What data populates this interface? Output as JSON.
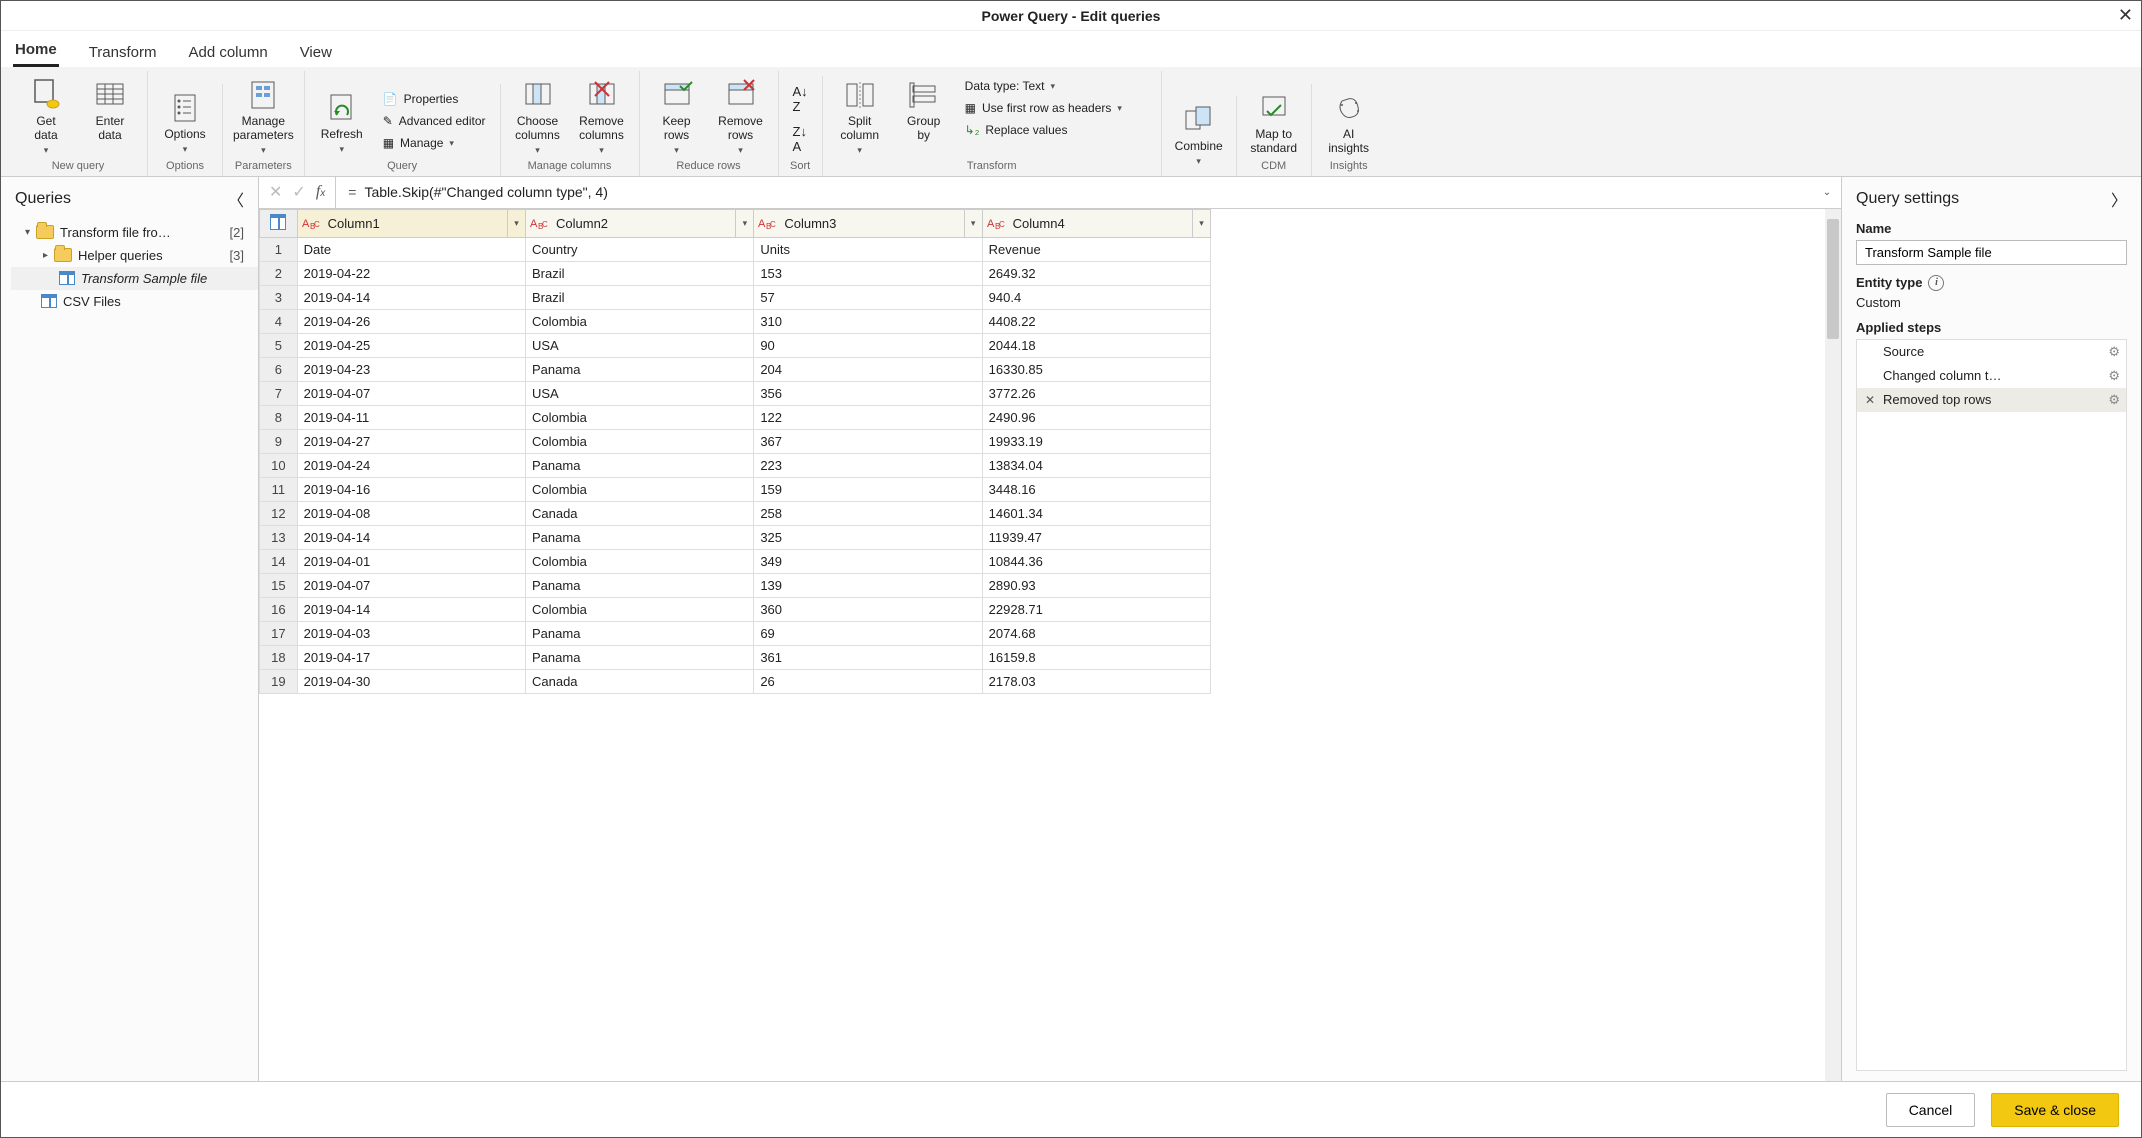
{
  "window": {
    "title": "Power Query - Edit queries"
  },
  "tabs": [
    {
      "label": "Home",
      "active": true
    },
    {
      "label": "Transform",
      "active": false
    },
    {
      "label": "Add column",
      "active": false
    },
    {
      "label": "View",
      "active": false
    }
  ],
  "ribbon": {
    "newquery": {
      "label": "New query",
      "get_data": "Get\ndata",
      "enter_data": "Enter\ndata"
    },
    "options": {
      "label": "Options",
      "options": "Options"
    },
    "parameters": {
      "label": "Parameters",
      "manage_parameters": "Manage\nparameters"
    },
    "query": {
      "label": "Query",
      "refresh": "Refresh",
      "properties": "Properties",
      "advanced_editor": "Advanced editor",
      "manage": "Manage"
    },
    "manage_columns": {
      "label": "Manage columns",
      "choose_columns": "Choose\ncolumns",
      "remove_columns": "Remove\ncolumns"
    },
    "reduce_rows": {
      "label": "Reduce rows",
      "keep_rows": "Keep\nrows",
      "remove_rows": "Remove\nrows"
    },
    "sort": {
      "label": "Sort"
    },
    "transform": {
      "label": "Transform",
      "split_column": "Split\ncolumn",
      "group_by": "Group\nby",
      "data_type": "Data type: Text",
      "first_row_headers": "Use first row as headers",
      "replace_values": "Replace values"
    },
    "combine": {
      "label": "",
      "combine": "Combine"
    },
    "cdm": {
      "label": "CDM",
      "map_to_standard": "Map to\nstandard"
    },
    "insights": {
      "label": "Insights",
      "ai_insights": "AI\ninsights"
    }
  },
  "queries": {
    "title": "Queries",
    "items": [
      {
        "icon": "folder",
        "label": "Transform file fro…",
        "count": "[2]",
        "depth": 0,
        "expand": "▾"
      },
      {
        "icon": "folder",
        "label": "Helper queries",
        "count": "[3]",
        "depth": 1,
        "expand": "▸"
      },
      {
        "icon": "table",
        "label": "Transform Sample file",
        "depth": 1,
        "selected": true
      },
      {
        "icon": "table",
        "label": "CSV Files",
        "depth": 0
      }
    ]
  },
  "formula": {
    "code": "Table.Skip(#\"Changed column type\", 4)"
  },
  "table": {
    "columns": [
      "Column1",
      "Column2",
      "Column3",
      "Column4"
    ],
    "selected_col": 0,
    "rows": [
      {
        "n": 1,
        "c": [
          "Date",
          "Country",
          "Units",
          "Revenue"
        ]
      },
      {
        "n": 2,
        "c": [
          "2019-04-22",
          "Brazil",
          "153",
          "2649.32"
        ]
      },
      {
        "n": 3,
        "c": [
          "2019-04-14",
          "Brazil",
          "57",
          "940.4"
        ]
      },
      {
        "n": 4,
        "c": [
          "2019-04-26",
          "Colombia",
          "310",
          "4408.22"
        ]
      },
      {
        "n": 5,
        "c": [
          "2019-04-25",
          "USA",
          "90",
          "2044.18"
        ]
      },
      {
        "n": 6,
        "c": [
          "2019-04-23",
          "Panama",
          "204",
          "16330.85"
        ]
      },
      {
        "n": 7,
        "c": [
          "2019-04-07",
          "USA",
          "356",
          "3772.26"
        ]
      },
      {
        "n": 8,
        "c": [
          "2019-04-11",
          "Colombia",
          "122",
          "2490.96"
        ]
      },
      {
        "n": 9,
        "c": [
          "2019-04-27",
          "Colombia",
          "367",
          "19933.19"
        ]
      },
      {
        "n": 10,
        "c": [
          "2019-04-24",
          "Panama",
          "223",
          "13834.04"
        ]
      },
      {
        "n": 11,
        "c": [
          "2019-04-16",
          "Colombia",
          "159",
          "3448.16"
        ]
      },
      {
        "n": 12,
        "c": [
          "2019-04-08",
          "Canada",
          "258",
          "14601.34"
        ]
      },
      {
        "n": 13,
        "c": [
          "2019-04-14",
          "Panama",
          "325",
          "11939.47"
        ]
      },
      {
        "n": 14,
        "c": [
          "2019-04-01",
          "Colombia",
          "349",
          "10844.36"
        ]
      },
      {
        "n": 15,
        "c": [
          "2019-04-07",
          "Panama",
          "139",
          "2890.93"
        ]
      },
      {
        "n": 16,
        "c": [
          "2019-04-14",
          "Colombia",
          "360",
          "22928.71"
        ]
      },
      {
        "n": 17,
        "c": [
          "2019-04-03",
          "Panama",
          "69",
          "2074.68"
        ]
      },
      {
        "n": 18,
        "c": [
          "2019-04-17",
          "Panama",
          "361",
          "16159.8"
        ]
      },
      {
        "n": 19,
        "c": [
          "2019-04-30",
          "Canada",
          "26",
          "2178.03"
        ]
      }
    ]
  },
  "settings": {
    "title": "Query settings",
    "name_label": "Name",
    "name_value": "Transform Sample file",
    "entity_label": "Entity type",
    "entity_value": "Custom",
    "steps_label": "Applied steps",
    "steps": [
      {
        "label": "Source",
        "gear": true,
        "selected": false,
        "x": false
      },
      {
        "label": "Changed column t…",
        "gear": true,
        "selected": false,
        "x": false
      },
      {
        "label": "Removed top rows",
        "gear": true,
        "selected": true,
        "x": true
      }
    ]
  },
  "footer": {
    "cancel": "Cancel",
    "save": "Save & close"
  }
}
